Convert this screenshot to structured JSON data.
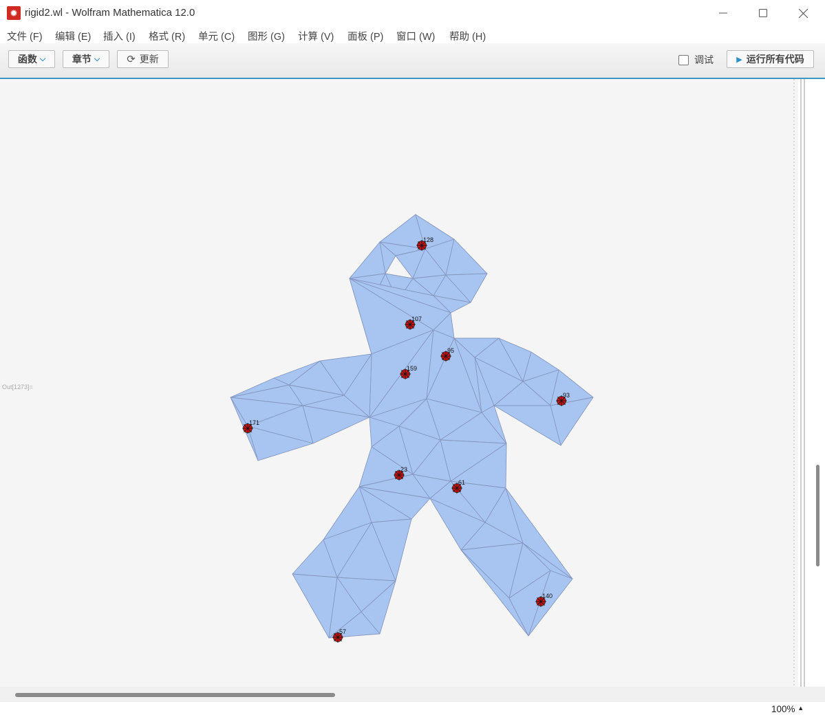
{
  "window": {
    "title": "rigid2.wl - Wolfram Mathematica 12.0",
    "app_icon": "mathematica-icon",
    "controls": [
      "minimize-icon",
      "maximize-icon",
      "close-icon"
    ]
  },
  "menu": [
    {
      "label": "文件 (F)"
    },
    {
      "label": "编辑 (E)"
    },
    {
      "label": "插入 (I)"
    },
    {
      "label": "格式 (R)"
    },
    {
      "label": "单元 (C)"
    },
    {
      "label": "图形 (G)"
    },
    {
      "label": "计算 (V)"
    },
    {
      "label": "面板 (P)"
    },
    {
      "label": "窗口 (W)"
    },
    {
      "label": "帮助 (H)"
    }
  ],
  "toolbar": {
    "functions_label": "函数",
    "sections_label": "章节",
    "update_label": "更新",
    "debug_label": "调试",
    "debug_checked": false,
    "run_all_label": "运行所有代码"
  },
  "notebook": {
    "output_label": "Out[1273]=",
    "mesh_fill": "#a8c5f2",
    "mesh_stroke": "#8598c0",
    "marker_color": "#d11010",
    "vertices": [
      {
        "id": "128",
        "label": "128"
      },
      {
        "id": "107",
        "label": "107"
      },
      {
        "id": "95",
        "label": "95"
      },
      {
        "id": "159",
        "label": "159"
      },
      {
        "id": "93",
        "label": "93"
      },
      {
        "id": "171",
        "label": "171"
      },
      {
        "id": "23",
        "label": "23"
      },
      {
        "id": "61",
        "label": "61"
      },
      {
        "id": "140",
        "label": "140"
      },
      {
        "id": "57",
        "label": "57"
      }
    ]
  },
  "status": {
    "zoom": "100%"
  }
}
